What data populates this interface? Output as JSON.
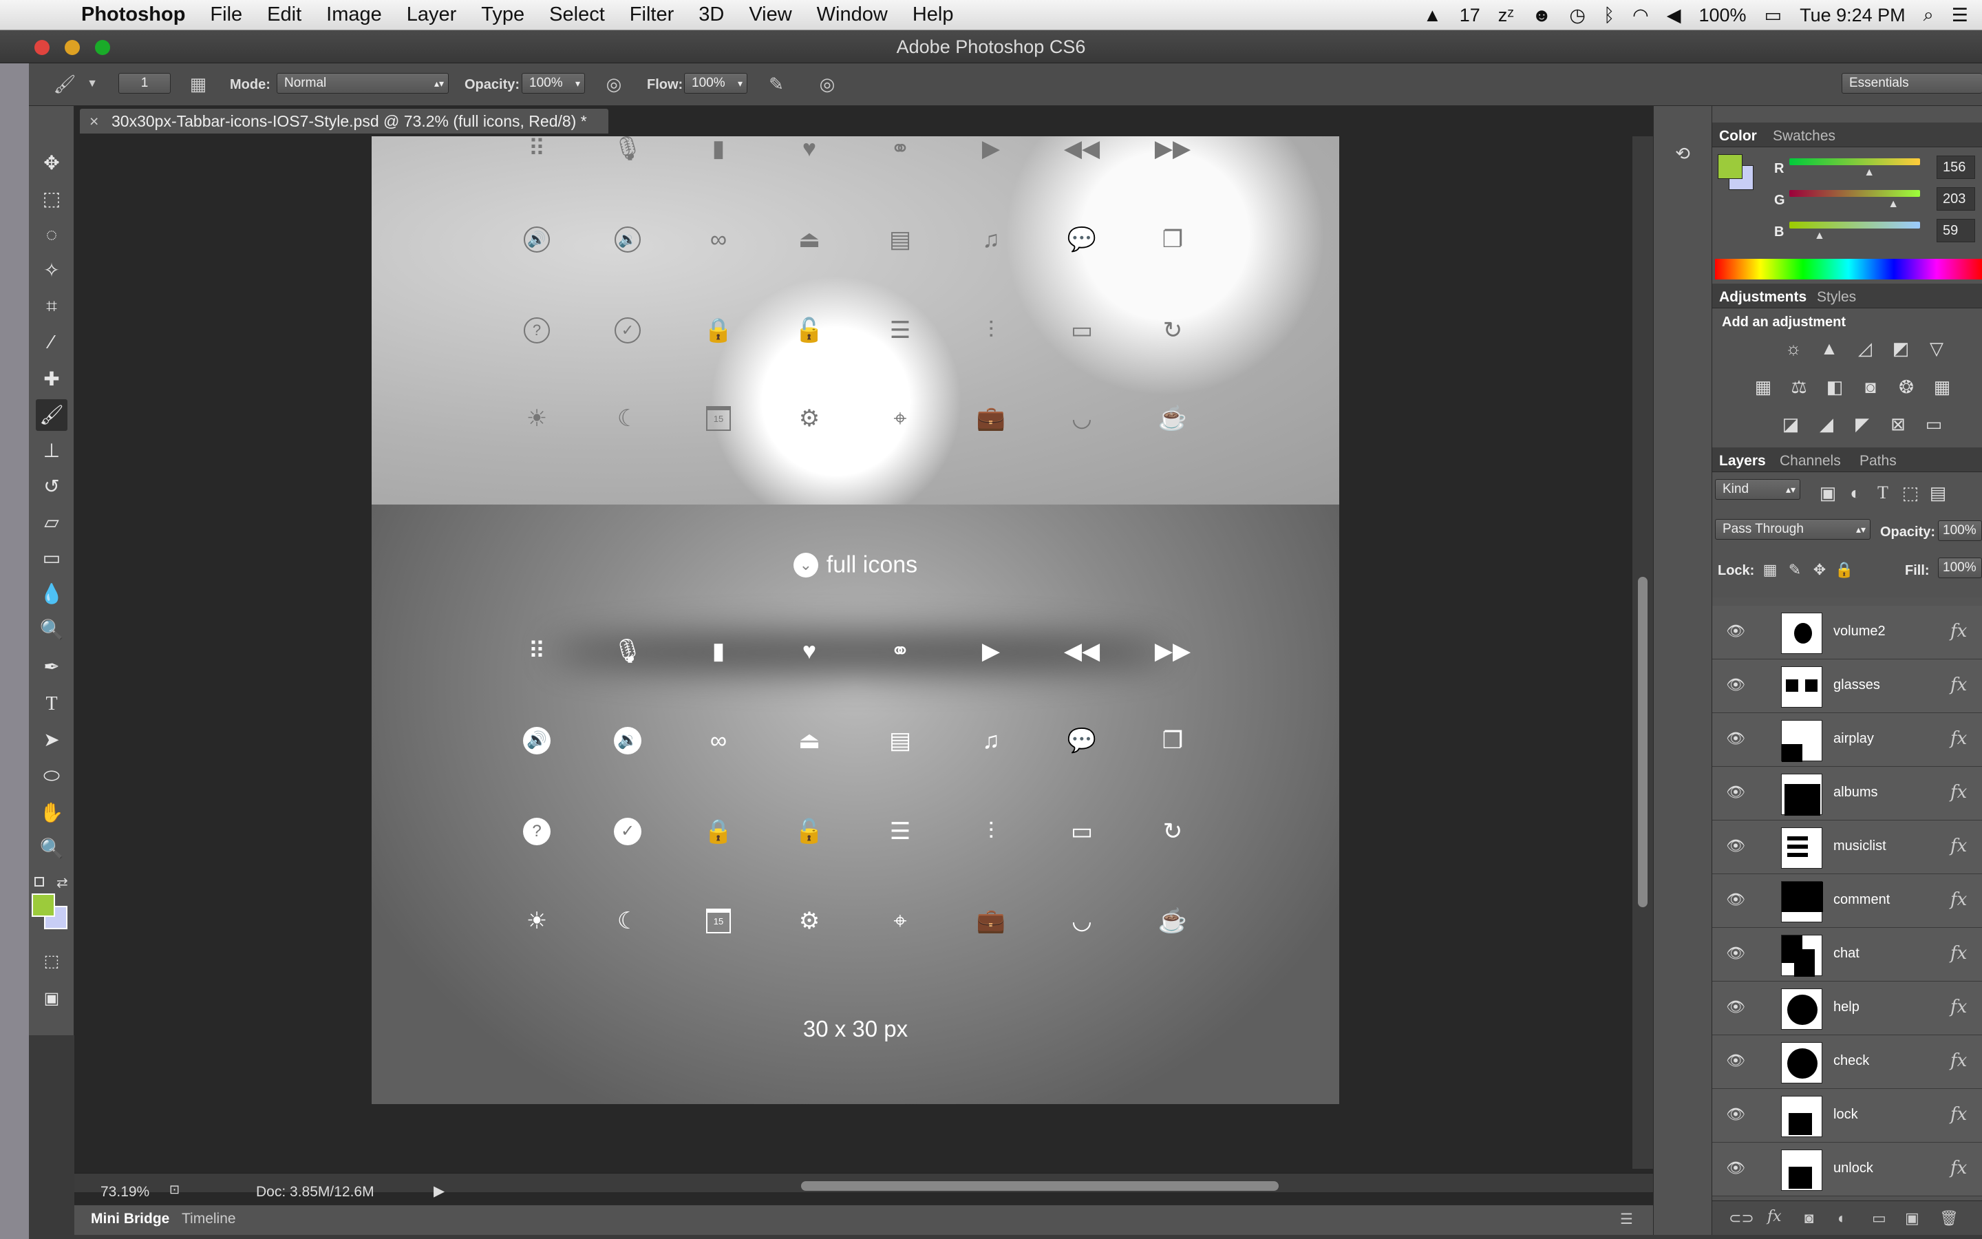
{
  "menubar": {
    "app_name": "Photoshop",
    "items": [
      "File",
      "Edit",
      "Image",
      "Layer",
      "Type",
      "Select",
      "Filter",
      "3D",
      "View",
      "Window",
      "Help"
    ],
    "status": {
      "adobe_count": "17",
      "battery": "100%",
      "clock": "Tue 9:24 PM"
    }
  },
  "window": {
    "title": "Adobe Photoshop CS6"
  },
  "options": {
    "brush_size": "1",
    "mode_label": "Mode:",
    "mode_value": "Normal",
    "opacity_label": "Opacity:",
    "opacity_value": "100%",
    "flow_label": "Flow:",
    "flow_value": "100%",
    "workspace": "Essentials"
  },
  "document": {
    "tab_title": "30x30px-Tabbar-icons-IOS7-Style.psd @ 73.2% (full icons, Red/8) *"
  },
  "canvas": {
    "section_title": "full icons",
    "size_caption": "30 x 30 px",
    "rows": [
      [
        "grid-icon",
        "microphone-icon",
        "flashlight-icon",
        "heart-icon",
        "voicemail-icon",
        "play-icon",
        "rewind-icon",
        "fast-forward-icon"
      ],
      [
        "volume-icon",
        "volume2-icon",
        "glasses-icon",
        "airplay-icon",
        "albums-icon",
        "musiclist-icon",
        "comment-icon",
        "chat-icon"
      ],
      [
        "help-icon",
        "check-icon",
        "lock-icon",
        "unlock-icon",
        "list-icon",
        "equalizer-icon",
        "battery-icon",
        "refresh-icon"
      ],
      [
        "sun-icon",
        "moon-icon",
        "calendar-icon",
        "gear-icon",
        "location-icon",
        "briefcase-icon",
        "bag-icon",
        "coffee-icon"
      ]
    ],
    "calendar_day": "15"
  },
  "status": {
    "zoom": "73.19%",
    "doc_size": "Doc: 3.85M/12.6M"
  },
  "bottom_tabs": [
    "Mini Bridge",
    "Timeline"
  ],
  "color_panel": {
    "tabs": [
      "Color",
      "Swatches"
    ],
    "r_label": "R",
    "g_label": "G",
    "b_label": "B",
    "r": 156,
    "g": 203,
    "b": 59,
    "fg_color": "#9ccb3b"
  },
  "adjustments_panel": {
    "tabs": [
      "Adjustments",
      "Styles"
    ],
    "heading": "Add an adjustment"
  },
  "layers_panel": {
    "tabs": [
      "Layers",
      "Channels",
      "Paths"
    ],
    "filter_kind": "Kind",
    "blend_mode": "Pass Through",
    "opacity_label": "Opacity:",
    "opacity": "100%",
    "lock_label": "Lock:",
    "fill_label": "Fill:",
    "fill": "100%",
    "layers": [
      "volume2",
      "glasses",
      "airplay",
      "albums",
      "musiclist",
      "comment",
      "chat",
      "help",
      "check",
      "lock",
      "unlock"
    ]
  }
}
